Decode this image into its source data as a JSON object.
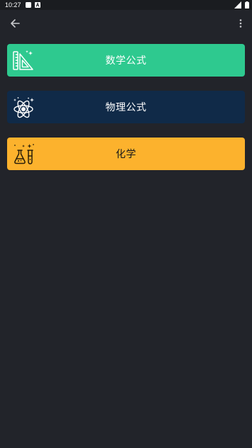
{
  "status_bar": {
    "time": "10:27",
    "icons": [
      "notification-square-icon",
      "notification-a-icon",
      "signal-icon",
      "battery-icon"
    ]
  },
  "app_bar": {
    "back_icon": "arrow-back-icon",
    "menu_icon": "more-vert-icon"
  },
  "colors": {
    "background": "#22242a",
    "math": "#2ec98f",
    "physics": "#102a48",
    "chemistry": "#fcb22d"
  },
  "categories": [
    {
      "label": "数学公式",
      "icon": "ruler-triangle-icon"
    },
    {
      "label": "物理公式",
      "icon": "atom-icon"
    },
    {
      "label": "化学",
      "icon": "flask-test-tube-icon"
    }
  ]
}
